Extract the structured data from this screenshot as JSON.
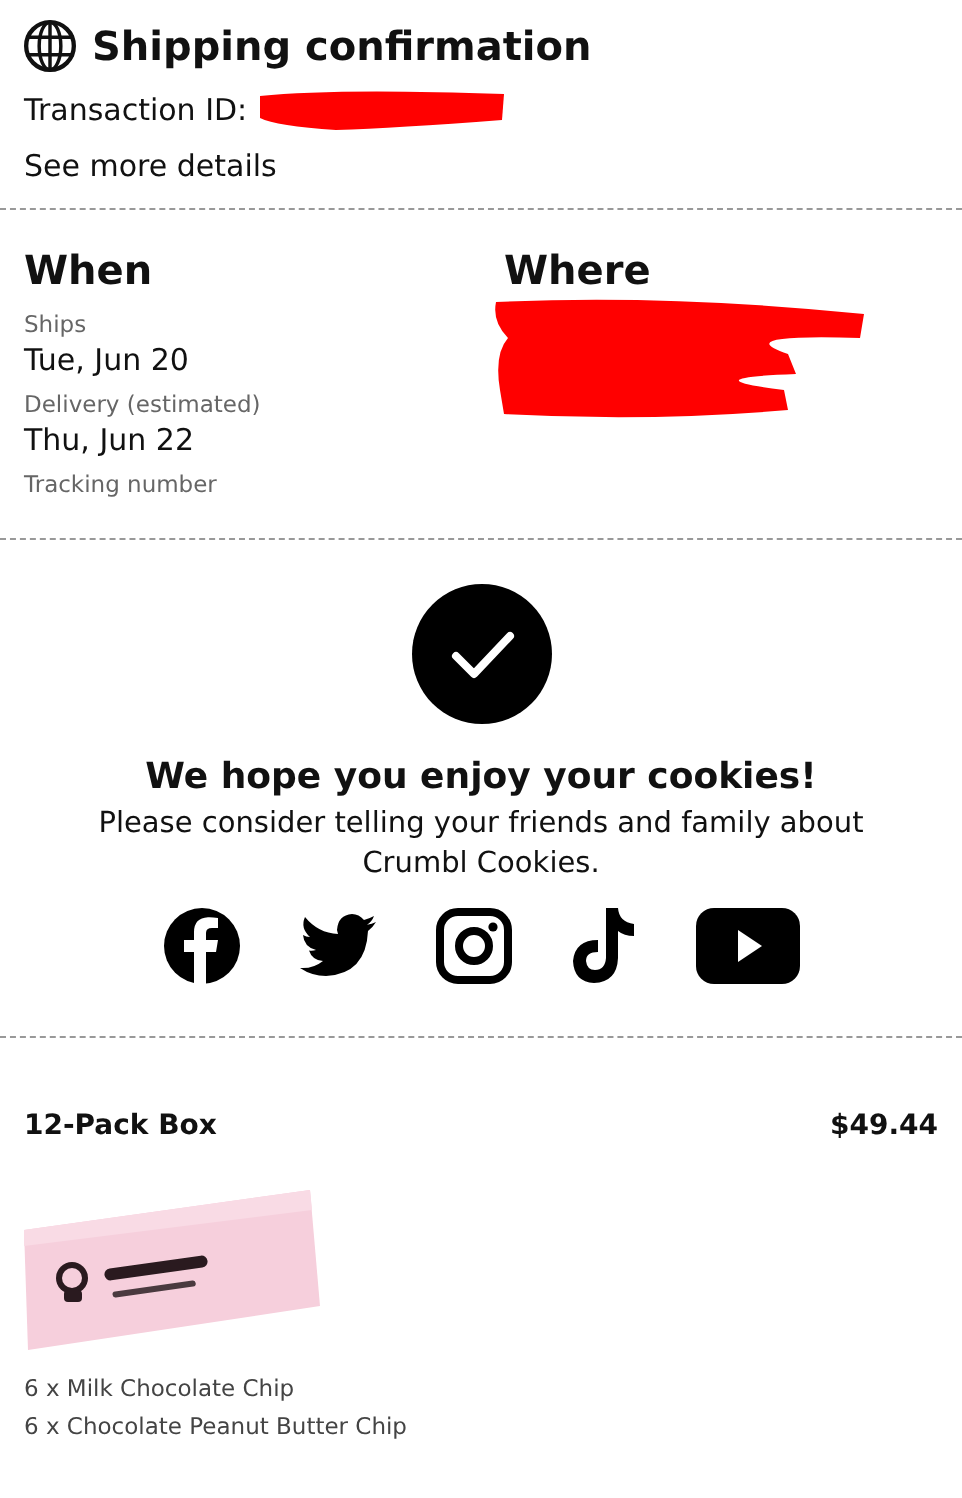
{
  "header": {
    "title": "Shipping confirmation",
    "transaction_label": "Transaction ID:",
    "details_link": "See more details"
  },
  "when": {
    "heading": "When",
    "ships_label": "Ships",
    "ships_date": "Tue, Jun 20",
    "delivery_label": "Delivery (estimated)",
    "delivery_date": "Thu, Jun 22",
    "tracking_label": "Tracking number"
  },
  "where": {
    "heading": "Where"
  },
  "thanks": {
    "heading": "We hope you enjoy your cookies!",
    "message": "Please consider telling your friends and family about Crumbl Cookies."
  },
  "social": [
    {
      "kind": "facebook"
    },
    {
      "kind": "twitter"
    },
    {
      "kind": "instagram"
    },
    {
      "kind": "tiktok"
    },
    {
      "kind": "youtube"
    }
  ],
  "order": {
    "name": "12-Pack Box",
    "price": "$49.44",
    "items": [
      "6 x Milk Chocolate Chip",
      "6 x Chocolate Peanut Butter Chip"
    ]
  }
}
